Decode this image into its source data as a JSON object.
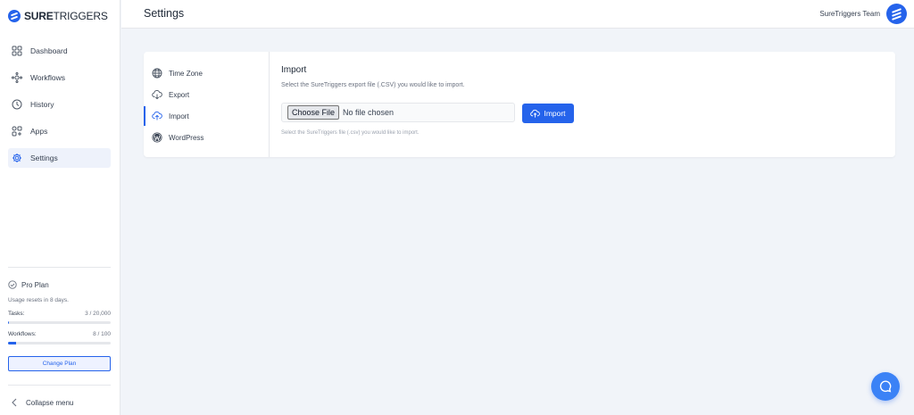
{
  "brand": {
    "name_bold": "SURE",
    "name_rest": "TRIGGERS",
    "color": "#2563eb"
  },
  "sidebar": {
    "items": [
      {
        "label": "Dashboard",
        "icon": "dashboard-grid-icon"
      },
      {
        "label": "Workflows",
        "icon": "workflow-icon"
      },
      {
        "label": "History",
        "icon": "history-clock-icon"
      },
      {
        "label": "Apps",
        "icon": "apps-icon"
      },
      {
        "label": "Settings",
        "icon": "gear-icon",
        "active": true
      }
    ],
    "plan": {
      "name": "Pro Plan",
      "reset_text": "Usage resets in 8 days.",
      "tasks_label": "Tasks:",
      "tasks_value": "3 / 20,000",
      "tasks_fraction": 0.00015,
      "workflows_label": "Workflows:",
      "workflows_value": "8 / 100",
      "workflows_fraction": 0.08,
      "change_button": "Change Plan"
    },
    "collapse_label": "Collapse menu"
  },
  "header": {
    "title": "Settings",
    "team": "SureTriggers Team"
  },
  "settings_nav": {
    "items": [
      {
        "label": "Time Zone",
        "icon": "globe-icon"
      },
      {
        "label": "Export",
        "icon": "cloud-download-icon"
      },
      {
        "label": "Import",
        "icon": "cloud-upload-icon",
        "active": true
      },
      {
        "label": "WordPress",
        "icon": "wordpress-icon"
      }
    ]
  },
  "import_panel": {
    "title": "Import",
    "description": "Select the SureTriggers export file (.CSV) you would like to import.",
    "choose_file_label": "Choose File",
    "no_file_text": "No file chosen",
    "import_button": "Import",
    "hint": "Select the SureTriggers file (.csv) you would like to import."
  }
}
